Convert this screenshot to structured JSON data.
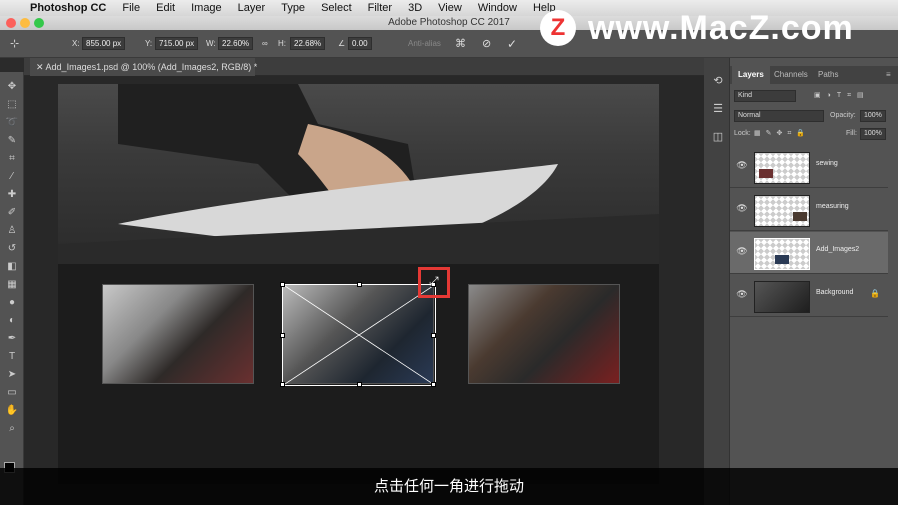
{
  "menubar": {
    "app_name": "Photoshop CC",
    "items": [
      "File",
      "Edit",
      "Image",
      "Layer",
      "Type",
      "Select",
      "Filter",
      "3D",
      "View",
      "Window",
      "Help"
    ]
  },
  "window_title": "Adobe Photoshop CC 2017",
  "options_bar": {
    "x_label": "X:",
    "x_value": "855.00 px",
    "y_label": "Y:",
    "y_value": "715.00 px",
    "w_label": "W:",
    "w_value": "22.60%",
    "h_label": "H:",
    "h_value": "22.68%",
    "angle_value": "0.00",
    "antialias_label": "Anti-alias"
  },
  "watermark": {
    "logo": "Z",
    "text": "www.MacZ.com"
  },
  "document_tab": "Add_Images1.psd @ 100% (Add_Images2, RGB/8) *",
  "layers_panel": {
    "tabs": [
      "Layers",
      "Channels",
      "Paths"
    ],
    "kind_placeholder": "Kind",
    "blend_mode": "Normal",
    "opacity_label": "Opacity:",
    "opacity_value": "100%",
    "lock_label": "Lock:",
    "fill_label": "Fill:",
    "fill_value": "100%",
    "layers": [
      {
        "name": "sewing",
        "selected": false
      },
      {
        "name": "measuring",
        "selected": false
      },
      {
        "name": "Add_Images2",
        "selected": true
      },
      {
        "name": "Background",
        "selected": false
      }
    ]
  },
  "subtitle": "点击任何一角进行拖动",
  "colors": {
    "highlight": "#e53935",
    "panel": "#535353",
    "canvas": "#282828"
  }
}
